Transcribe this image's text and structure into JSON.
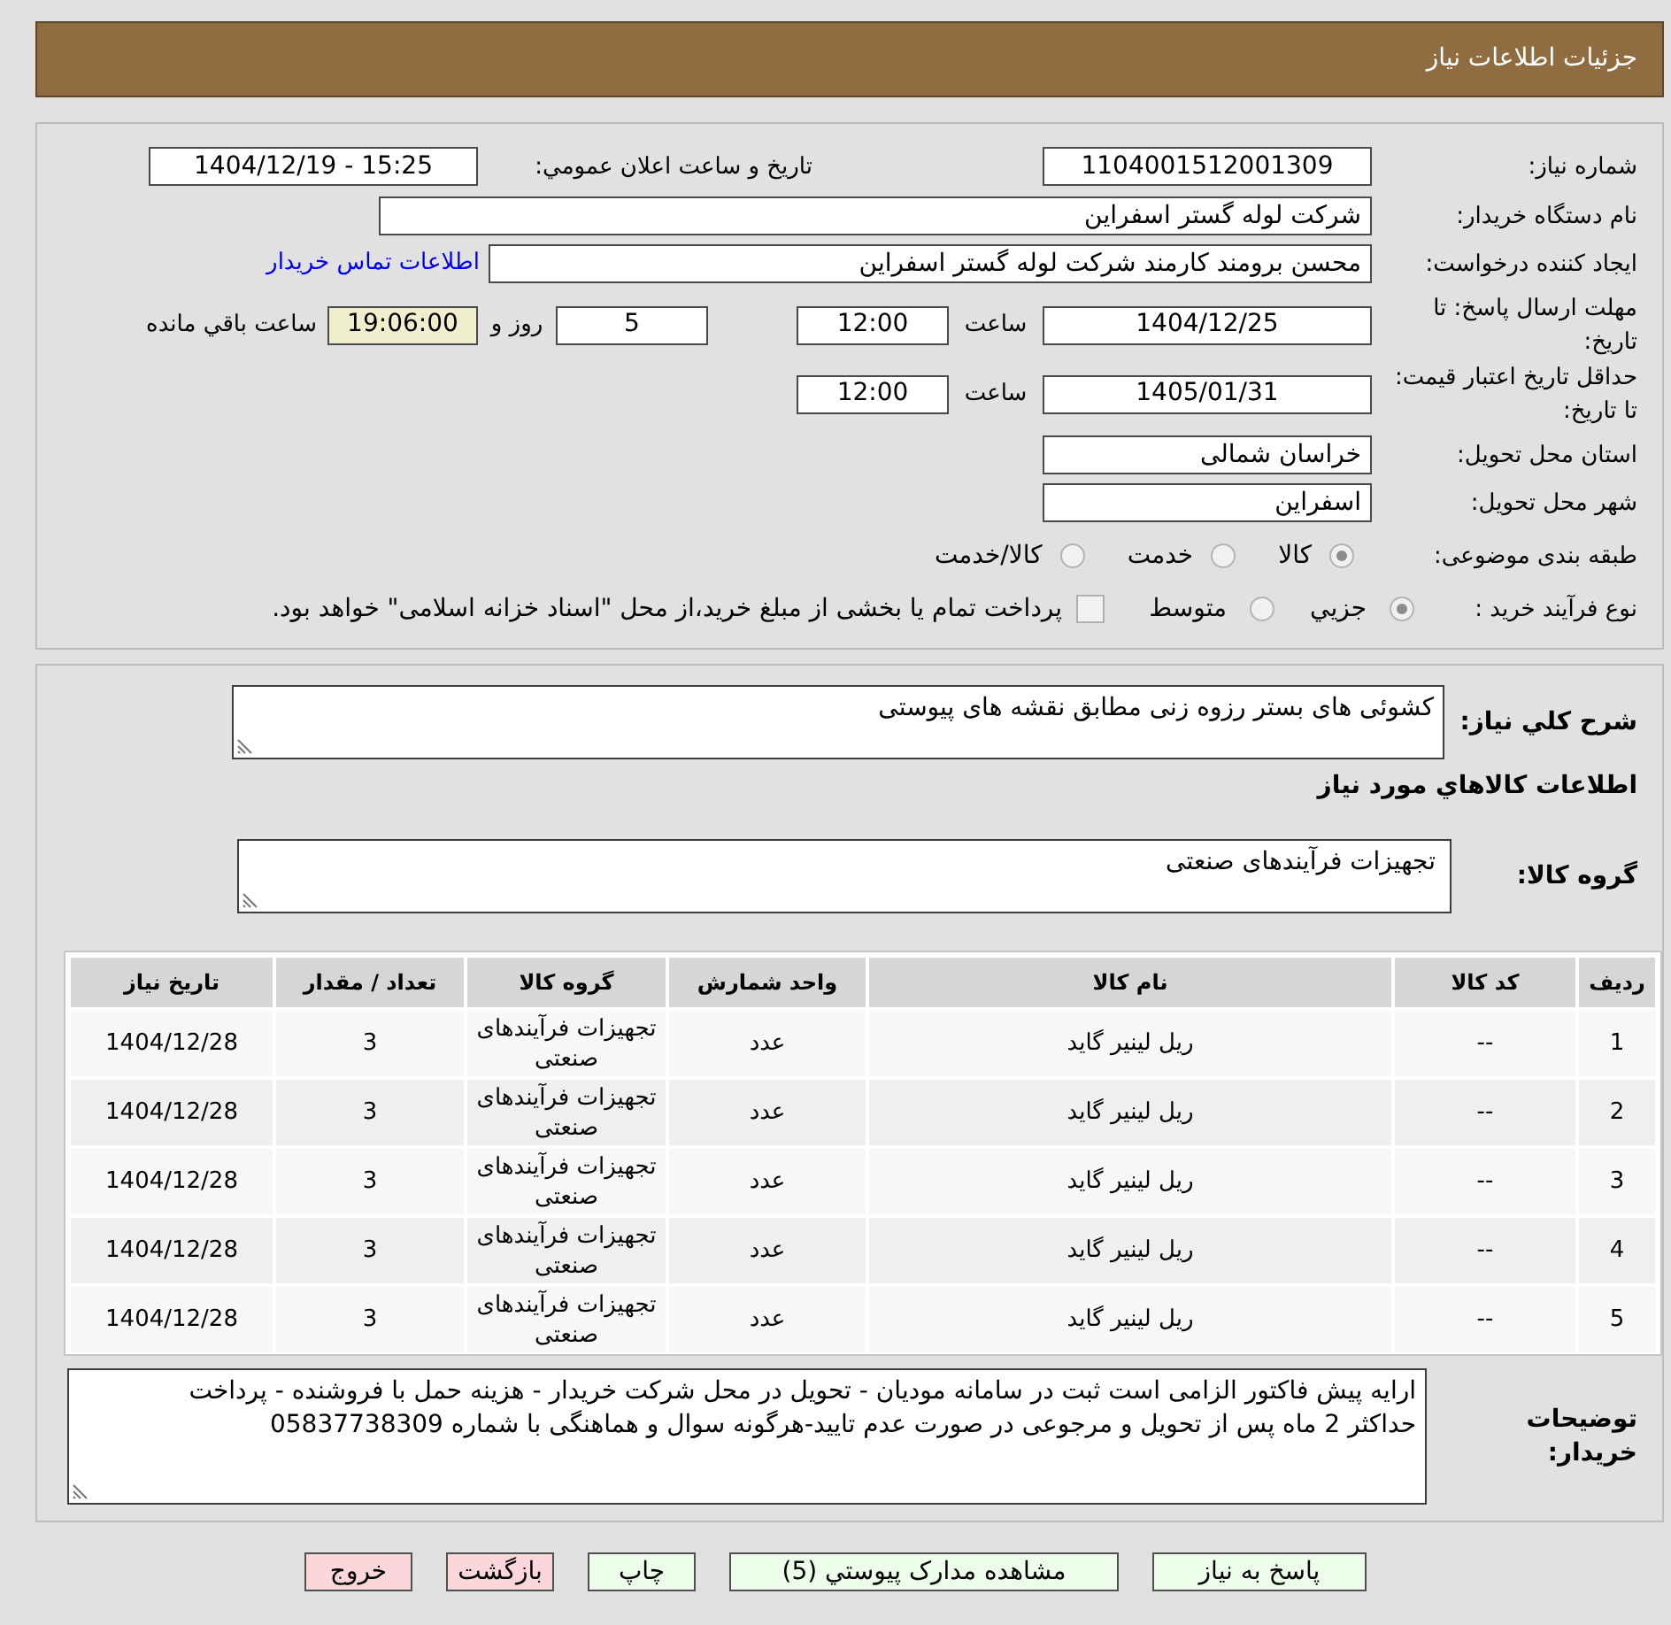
{
  "header": {
    "title": "جزئیات اطلاعات نیاز"
  },
  "details": {
    "need_number": {
      "label": "شماره نیاز:",
      "value": "1104001512001309"
    },
    "announcement": {
      "label": "تاریخ و ساعت اعلان عمومي:",
      "value": "1404/12/19 - 15:25"
    },
    "buyer_org": {
      "label": "نام دستگاه خریدار:",
      "value": "شرکت لوله گستر اسفراین"
    },
    "requester": {
      "label": "ایجاد کننده درخواست:",
      "value": "محسن برومند کارمند شرکت لوله گستر اسفراین",
      "contact_link": "اطلاعات تماس خریدار"
    },
    "reply_deadline": {
      "label": "مهلت ارسال پاسخ: تا تاریخ:",
      "date": "1404/12/25",
      "time_label": "ساعت",
      "time": "12:00",
      "days": "5",
      "days_label": "روز و",
      "remaining": "19:06:00",
      "remaining_label": "ساعت باقي مانده"
    },
    "price_validity": {
      "label": "حداقل تاریخ اعتبار قیمت: تا تاریخ:",
      "date": "1405/01/31",
      "time_label": "ساعت",
      "time": "12:00"
    },
    "province": {
      "label": "استان محل تحویل:",
      "value": "خراسان شمالی"
    },
    "city": {
      "label": "شهر محل تحویل:",
      "value": "اسفراین"
    },
    "subject_category": {
      "label": "طبقه بندی موضوعی:",
      "options": [
        {
          "label": "کالا",
          "selected": true
        },
        {
          "label": "خدمت",
          "selected": false
        },
        {
          "label": "کالا/خدمت",
          "selected": false
        }
      ]
    },
    "purchase_process": {
      "label": "نوع فرآیند خرید :",
      "options": [
        {
          "label": "جزيي",
          "selected": true
        },
        {
          "label": "متوسط",
          "selected": false
        }
      ],
      "treasury_payment": {
        "label": "پرداخت تمام یا بخشی از مبلغ خرید،از محل \"اسناد خزانه اسلامی\" خواهد بود.",
        "checked": false
      }
    }
  },
  "need": {
    "description_label": "شرح کلي نیاز:",
    "description": "کشوئی های بستر رزوه زنی مطابق نقشه های پیوستی",
    "goods_heading": "اطلاعات کالاهاي مورد نیاز",
    "group_label": "گروه کالا:",
    "group": "تجهیزات فرآیندهای صنعتی"
  },
  "goods_table": {
    "columns": [
      "ردیف",
      "کد کالا",
      "نام کالا",
      "واحد شمارش",
      "گروه کالا",
      "تعداد / مقدار",
      "تاریخ نیاز"
    ],
    "rows": [
      [
        "1",
        "--",
        "ریل لینیر گاید",
        "عدد",
        "تجهیزات فرآیندهای صنعتی",
        "3",
        "1404/12/28"
      ],
      [
        "2",
        "--",
        "ریل لینیر گاید",
        "عدد",
        "تجهیزات فرآیندهای صنعتی",
        "3",
        "1404/12/28"
      ],
      [
        "3",
        "--",
        "ریل لینیر گاید",
        "عدد",
        "تجهیزات فرآیندهای صنعتی",
        "3",
        "1404/12/28"
      ],
      [
        "4",
        "--",
        "ریل لینیر گاید",
        "عدد",
        "تجهیزات فرآیندهای صنعتی",
        "3",
        "1404/12/28"
      ],
      [
        "5",
        "--",
        "ریل لینیر گاید",
        "عدد",
        "تجهیزات فرآیندهای صنعتی",
        "3",
        "1404/12/28"
      ]
    ]
  },
  "buyer_notes": {
    "label": "توضیحات خریدار:",
    "text": "ارایه پیش فاکتور الزامی است ثبت در سامانه مودیان - تحویل در محل شرکت خریدار - هزینه حمل با فروشنده - پرداخت حداکثر 2 ماه پس از تحویل و مرجوعی در صورت عدم تایید-هرگونه سوال و هماهنگی با شماره 05837738309"
  },
  "buttons": [
    {
      "label": "پاسخ به نیاز",
      "kind": "action"
    },
    {
      "label": "مشاهده مدارک پیوستي (5)",
      "kind": "action"
    },
    {
      "label": "چاپ",
      "kind": "action"
    },
    {
      "label": "بازگشت",
      "kind": "exit"
    },
    {
      "label": "خروج",
      "kind": "exit"
    }
  ]
}
